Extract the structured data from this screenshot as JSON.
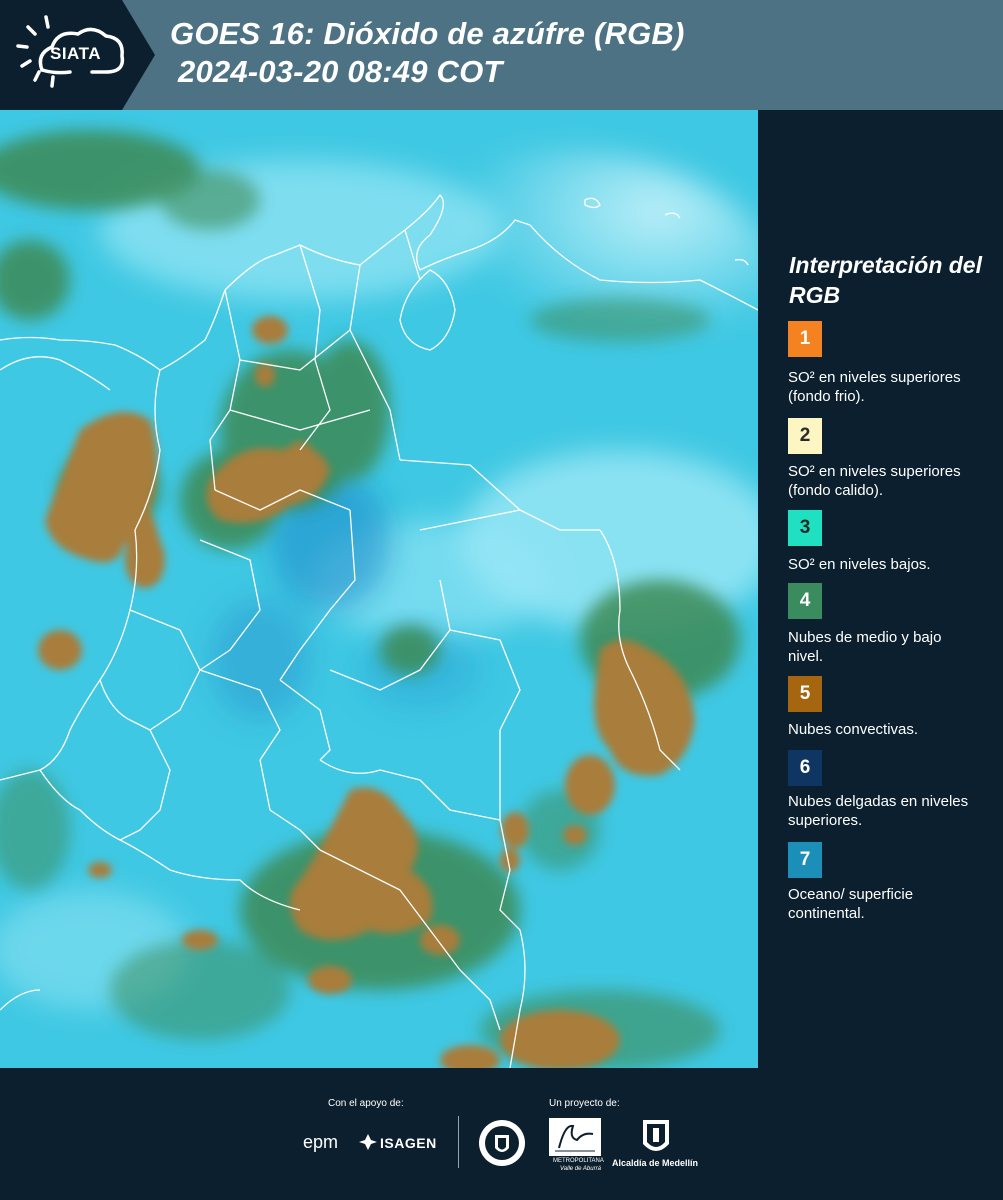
{
  "header": {
    "logo_text": "SIATA",
    "title_line1": "GOES 16: Dióxido de azúfre (RGB)",
    "title_line2": "2024-03-20 08:49 COT"
  },
  "legend": {
    "title": "Interpretación del RGB",
    "items": [
      {
        "num": "1",
        "color": "#f58220",
        "label": "SO² en niveles superiores (fondo frio)."
      },
      {
        "num": "2",
        "color": "#fdf6c3",
        "label": "SO² en niveles superiores (fondo calido)."
      },
      {
        "num": "3",
        "color": "#1fe0c0",
        "label": "SO² en niveles bajos."
      },
      {
        "num": "4",
        "color": "#3a8c5f",
        "label": "Nubes de medio y bajo nivel."
      },
      {
        "num": "5",
        "color": "#a6650f",
        "label": "Nubes convectivas."
      },
      {
        "num": "6",
        "color": "#0f3562",
        "label": "Nubes delgadas en niveles superiores."
      },
      {
        "num": "7",
        "color": "#1c8fb8",
        "label": "Oceano/ superficie continental."
      }
    ]
  },
  "footer": {
    "support_label": "Con el apoyo de:",
    "project_label": "Un proyecto de:",
    "logos": [
      "epm",
      "ISAGEN",
      "METROPOLITANA",
      "Valle de Aburrá",
      "Alcaldía de Medellín"
    ]
  },
  "map_colors": {
    "base": "#3fc8e3",
    "convective": "#a97d3a",
    "mid_low": "#3e8a55",
    "borders": "#ffffff"
  }
}
